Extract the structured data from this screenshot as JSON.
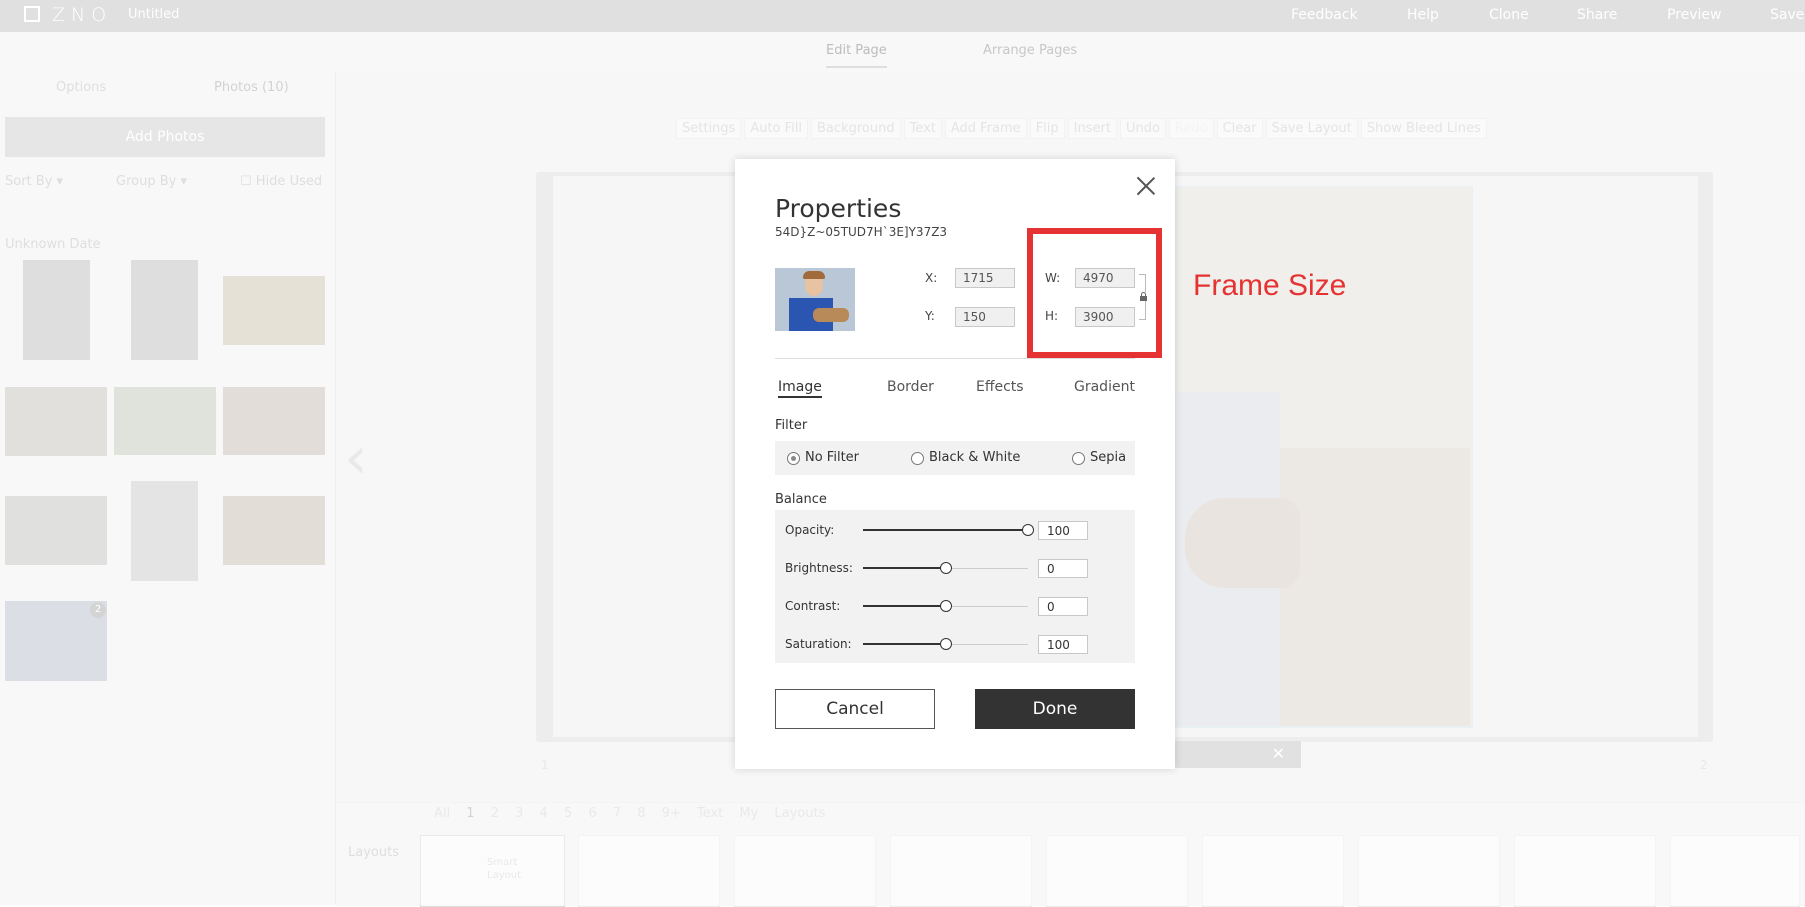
{
  "app": {
    "brand": "ZNO",
    "doc_title": "Untitled"
  },
  "topnav": [
    "Feedback",
    "Help",
    "Clone",
    "Share",
    "Preview",
    "Save"
  ],
  "subnav": {
    "edit_page": "Edit Page",
    "arrange_pages": "Arrange Pages"
  },
  "left_panel": {
    "tab_options": "Options",
    "tab_photos": "Photos (10)",
    "add_photos": "Add Photos",
    "sort_by": "Sort By",
    "group_by": "Group By",
    "hide_used": "Hide Used",
    "date_group": "Unknown Date",
    "badge": "2"
  },
  "toolbar": [
    "Settings",
    "Auto Fill",
    "Background",
    "Text",
    "Add Frame",
    "Flip",
    "Insert",
    "Undo",
    "Redo",
    "Clear",
    "Save Layout",
    "Show Bleed Lines"
  ],
  "page_numbers": {
    "left": "1",
    "right": "2"
  },
  "bottom": {
    "filters": [
      "All",
      "1",
      "2",
      "3",
      "4",
      "5",
      "6",
      "7",
      "8",
      "9+",
      "Text",
      "My Layouts"
    ],
    "layouts_label": "Layouts",
    "smart_layout": "Smart Layout"
  },
  "modal": {
    "title": "Properties",
    "image_id": "54D}Z~05TUD7H`3E]Y37Z3",
    "x_label": "X:",
    "x_value": "1715",
    "y_label": "Y:",
    "y_value": "150",
    "w_label": "W:",
    "w_value": "4970",
    "h_label": "H:",
    "h_value": "3900",
    "tabs": [
      "Image",
      "Border",
      "Effects",
      "Gradient"
    ],
    "filter_title": "Filter",
    "filters": [
      "No Filter",
      "Black & White",
      "Sepia"
    ],
    "selected_filter": "No Filter",
    "balance_title": "Balance",
    "sliders": [
      {
        "label": "Opacity:",
        "value": "100",
        "level": 1.0
      },
      {
        "label": "Brightness:",
        "value": "0",
        "level": 0.5
      },
      {
        "label": "Contrast:",
        "value": "0",
        "level": 0.5
      },
      {
        "label": "Saturation:",
        "value": "100",
        "level": 0.5
      }
    ],
    "cancel": "Cancel",
    "done": "Done"
  },
  "annotation": {
    "label": "Frame Size",
    "color": "#e53333"
  }
}
